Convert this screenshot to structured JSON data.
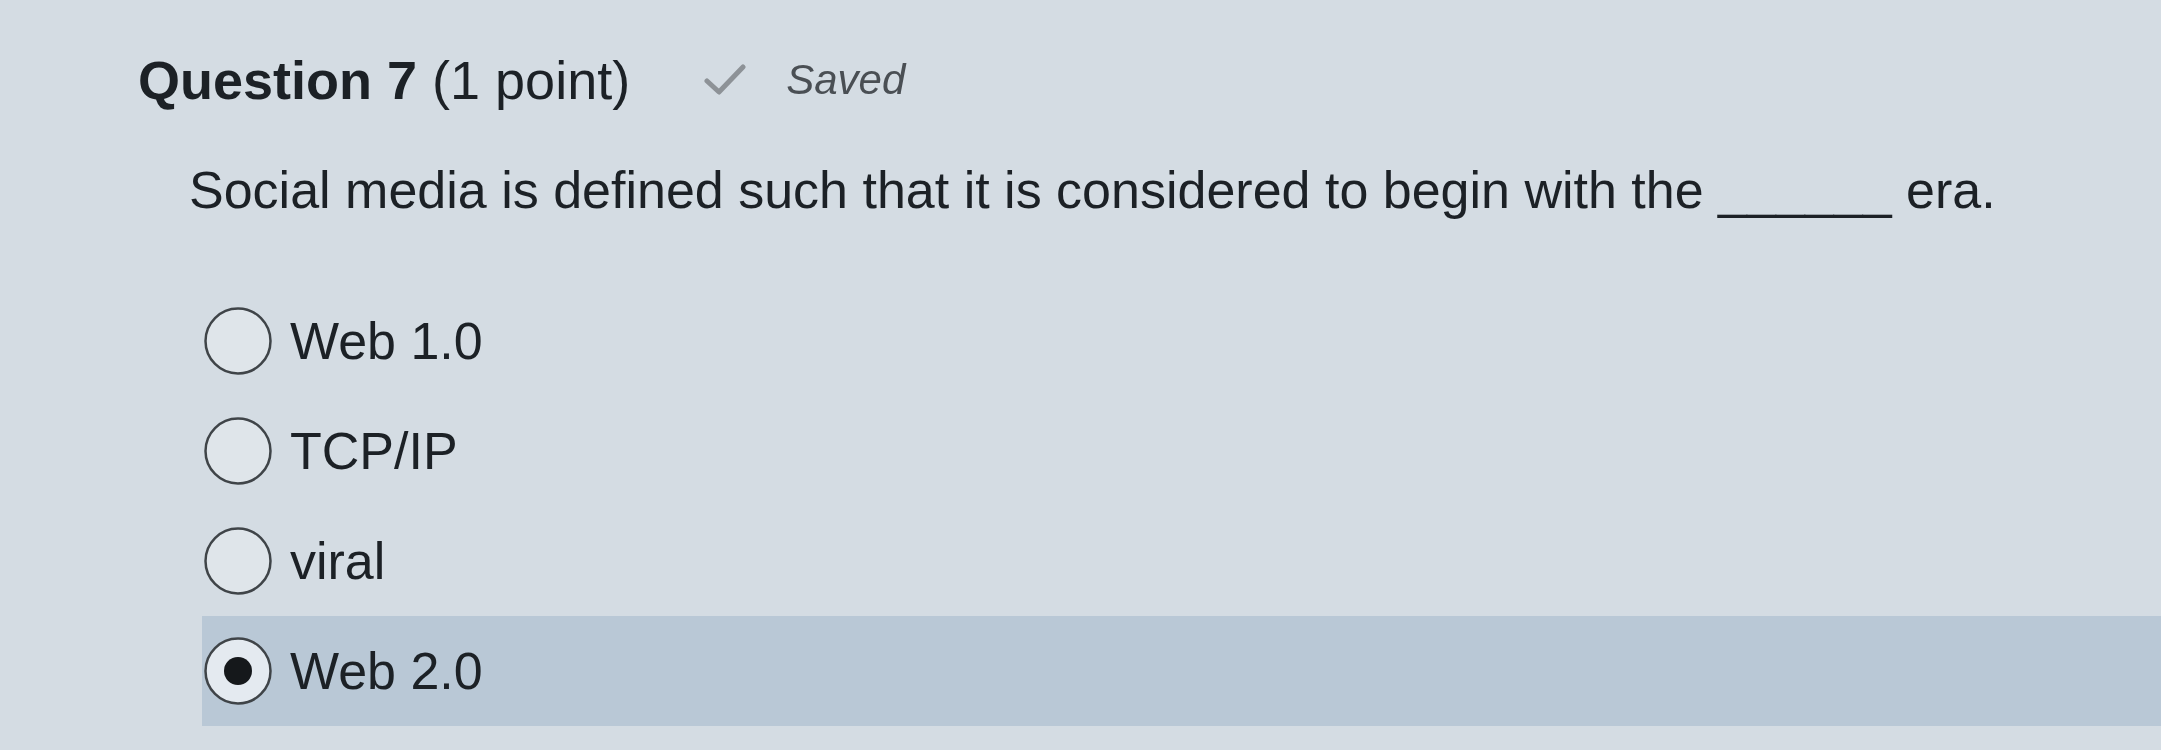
{
  "question": {
    "title": "**Question 7** (1 point)",
    "status": "Saved",
    "prompt": "Social media is defined such that it is considered to begin with the ______ era."
  },
  "options": [
    {
      "label": "Web 1.0",
      "selected": false
    },
    {
      "label": "TCP/IP",
      "selected": false
    },
    {
      "label": "viral",
      "selected": false
    },
    {
      "label": "Web 2.0",
      "selected": true
    }
  ]
}
